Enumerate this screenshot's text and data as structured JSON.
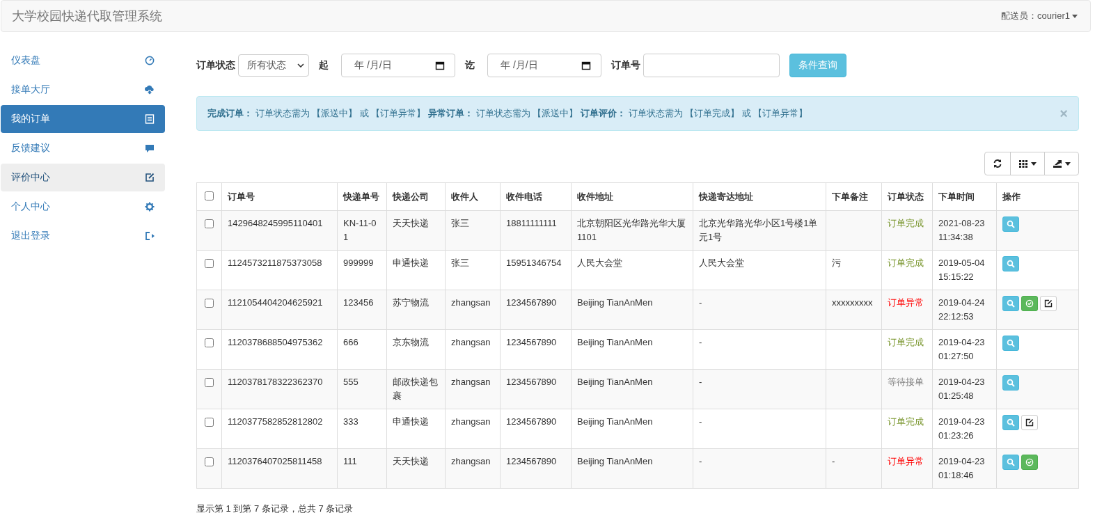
{
  "navbar": {
    "title": "大学校园快递代取管理系统",
    "user": "配送员：courier1"
  },
  "sidebar": {
    "items": [
      {
        "label": "仪表盘",
        "kind": "dashboard",
        "selected": false,
        "highlighted": false
      },
      {
        "label": "接单大厅",
        "kind": "cloud",
        "selected": false,
        "highlighted": false
      },
      {
        "label": "我的订单",
        "kind": "list",
        "selected": true,
        "highlighted": false
      },
      {
        "label": "反馈建议",
        "kind": "comment",
        "selected": false,
        "highlighted": false
      },
      {
        "label": "评价中心",
        "kind": "edit",
        "selected": false,
        "highlighted": true
      },
      {
        "label": "个人中心",
        "kind": "gear",
        "selected": false,
        "highlighted": false
      },
      {
        "label": "退出登录",
        "kind": "logout",
        "selected": false,
        "highlighted": false
      }
    ]
  },
  "filter": {
    "status_label": "订单状态",
    "status_value": "所有状态",
    "from_label": "起",
    "from_placeholder": "年 /月/日",
    "to_label": "讫",
    "to_placeholder": "年 /月/日",
    "order_label": "订单号",
    "query_button": "条件查询"
  },
  "alert": {
    "text": "**完成订单：** 订单状态需为 【派送中】 或 【订单异常】 **异常订单：** 订单状态需为 【派送中】 **订单评价：** 订单状态需为 【订单完成】 或 【订单异常】",
    "close": "×"
  },
  "table": {
    "all_checked": false,
    "columns": [
      "订单号",
      "快递单号",
      "快递公司",
      "收件人",
      "收件电话",
      "收件地址",
      "快递寄达地址",
      "下单备注",
      "订单状态",
      "下单时间",
      "操作"
    ],
    "rows": [
      {
        "checked": false,
        "cells": [
          "1429648245995110401",
          "KN-11-01",
          "天天快递",
          "张三",
          "18811111111",
          "北京朝阳区光华路光华大厦1101",
          "北京光华路光华小区1号楼1单元1号",
          ""
        ],
        "status": {
          "text": "订单完成",
          "kind": "complete"
        },
        "time": [
          "2021-08-23",
          "11:34:38"
        ],
        "actions": [
          {
            "kind": "view"
          }
        ]
      },
      {
        "checked": false,
        "cells": [
          "1124573211875373058",
          "999999",
          "申通快递",
          "张三",
          "15951346754",
          "人民大会堂",
          "人民大会堂",
          "污"
        ],
        "status": {
          "text": "订单完成",
          "kind": "complete"
        },
        "time": [
          "2019-05-04",
          "15:15:22"
        ],
        "actions": [
          {
            "kind": "view"
          }
        ]
      },
      {
        "checked": false,
        "cells": [
          "1121054404204625921",
          "123456",
          "苏宁物流",
          "zhangsan",
          "1234567890",
          "Beijing TianAnMen",
          "-",
          "xxxxxxxxx"
        ],
        "status": {
          "text": "订单异常",
          "kind": "abnormal"
        },
        "time": [
          "2019-04-24",
          "22:12:53"
        ],
        "actions": [
          {
            "kind": "view"
          },
          {
            "kind": "complete"
          },
          {
            "kind": "rate"
          }
        ]
      },
      {
        "checked": false,
        "cells": [
          "1120378688504975362",
          "666",
          "京东物流",
          "zhangsan",
          "1234567890",
          "Beijing TianAnMen",
          "-",
          ""
        ],
        "status": {
          "text": "订单完成",
          "kind": "complete"
        },
        "time": [
          "2019-04-23",
          "01:27:50"
        ],
        "actions": [
          {
            "kind": "view"
          }
        ]
      },
      {
        "checked": false,
        "cells": [
          "1120378178322362370",
          "555",
          "邮政快递包裹",
          "zhangsan",
          "1234567890",
          "Beijing TianAnMen",
          "-",
          ""
        ],
        "status": {
          "text": "等待接单",
          "kind": "waiting"
        },
        "time": [
          "2019-04-23",
          "01:25:48"
        ],
        "actions": [
          {
            "kind": "view"
          }
        ]
      },
      {
        "checked": false,
        "cells": [
          "1120377582852812802",
          "333",
          "申通快递",
          "zhangsan",
          "1234567890",
          "Beijing TianAnMen",
          "-",
          ""
        ],
        "status": {
          "text": "订单完成",
          "kind": "complete"
        },
        "time": [
          "2019-04-23",
          "01:23:26"
        ],
        "actions": [
          {
            "kind": "view"
          },
          {
            "kind": "rate"
          }
        ]
      },
      {
        "checked": false,
        "cells": [
          "1120376407025811458",
          "111",
          "天天快递",
          "zhangsan",
          "1234567890",
          "Beijing TianAnMen",
          "-",
          "-"
        ],
        "status": {
          "text": "订单异常",
          "kind": "abnormal"
        },
        "time": [
          "2019-04-23",
          "01:18:46"
        ],
        "actions": [
          {
            "kind": "view"
          },
          {
            "kind": "complete"
          }
        ]
      }
    ]
  },
  "footer": "显示第 1 到第 7 条记录，总共 7 条记录"
}
